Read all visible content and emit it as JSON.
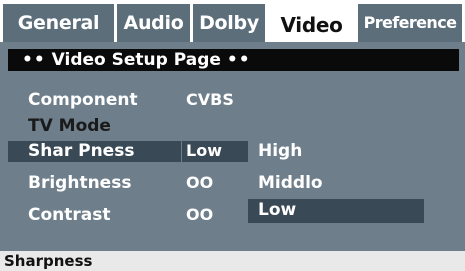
{
  "tabs": [
    {
      "label": "General"
    },
    {
      "label": "Audio"
    },
    {
      "label": "Dolby"
    },
    {
      "label": "Video",
      "active": true
    },
    {
      "label": "Preference"
    }
  ],
  "page_title": {
    "dots_left": "••",
    "text": "Video Setup Page",
    "dots_right": "••"
  },
  "settings": {
    "component": {
      "label": "Component",
      "value": "CVBS"
    },
    "tv_mode": {
      "label": "TV Mode"
    },
    "sharpness": {
      "label": "Shar Pness",
      "value": "Low"
    },
    "brightness": {
      "label": "Brightness",
      "value": "OO"
    },
    "contrast": {
      "label": "Contrast",
      "value": "OO"
    }
  },
  "options": {
    "items": [
      "High",
      "Middlo",
      "Low"
    ],
    "selected": "Low"
  },
  "status_bar": {
    "text": "Sharpness"
  },
  "colors": {
    "tab_bg": "#5d6e7b",
    "panel_bg": "#6e7e8b",
    "highlight": "#394956",
    "title_bar": "#0a0a0a"
  }
}
